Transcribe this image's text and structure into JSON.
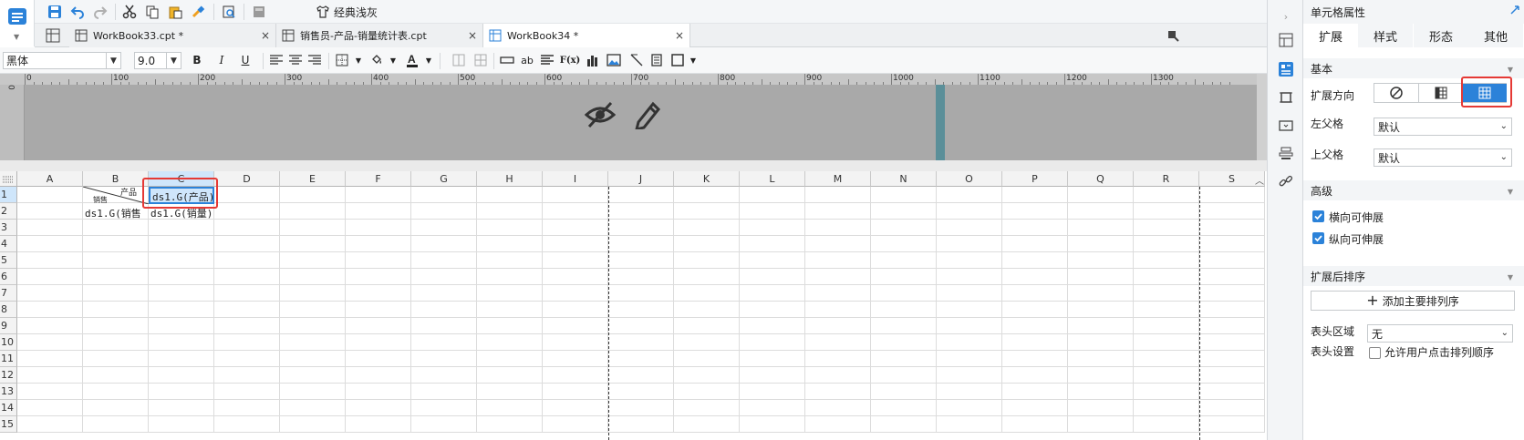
{
  "top_toolbar": {
    "theme_label": "经典浅灰"
  },
  "tabs": [
    {
      "label": "WorkBook33.cpt *",
      "close": "×",
      "active": false
    },
    {
      "label": "销售员-产品-销量统计表.cpt",
      "close": "×",
      "active": false
    },
    {
      "label": "WorkBook34 *",
      "close": "×",
      "active": true
    }
  ],
  "format_toolbar": {
    "font_name": "黑体",
    "font_size": "9.0",
    "bold": "B",
    "italic": "I",
    "underline": "U",
    "wrap_text": "ab",
    "formula": "F(x)"
  },
  "ruler": {
    "labels": [
      "0",
      "100",
      "200",
      "300",
      "400",
      "500",
      "600",
      "700",
      "800",
      "900",
      "1000",
      "1100",
      "1200",
      "1300"
    ],
    "vertical_label": "0"
  },
  "grid": {
    "columns": [
      "A",
      "B",
      "C",
      "D",
      "E",
      "F",
      "G",
      "H",
      "I",
      "J",
      "K",
      "L",
      "M",
      "N",
      "O",
      "P",
      "Q",
      "R",
      "S"
    ],
    "rows": [
      "1",
      "2",
      "3",
      "4",
      "5",
      "6",
      "7",
      "8",
      "9",
      "10",
      "11",
      "12",
      "13",
      "14",
      "15"
    ],
    "cells": {
      "B1_top": "产品",
      "B1_bottom": "销售",
      "C1": "ds1.G(产品)",
      "B2": "ds1.G(销售",
      "C2": "ds1.G(销量)"
    }
  },
  "panel": {
    "title": "单元格属性",
    "tabs": [
      "扩展",
      "样式",
      "形态",
      "其他"
    ],
    "active_tab": "扩展",
    "basic": {
      "header": "基本",
      "direction_label": "扩展方向",
      "left_parent_label": "左父格",
      "left_parent_value": "默认",
      "top_parent_label": "上父格",
      "top_parent_value": "默认"
    },
    "advanced": {
      "header": "高级",
      "horizontal_label": "横向可伸展",
      "horizontal_checked": true,
      "vertical_label": "纵向可伸展",
      "vertical_checked": true
    },
    "sort": {
      "header": "扩展后排序",
      "add_button": "添加主要排列序",
      "header_area_label": "表头区域",
      "header_area_value": "无",
      "header_settings_label": "表头设置",
      "allow_click_sort_label": "允许用户点击排列顺序",
      "allow_click_sort_checked": false
    }
  },
  "colors": {
    "accent": "#2b82d9",
    "highlight_red": "#e53935",
    "selected_cell": "#cfe6fb",
    "header_band": "#a9a9a9"
  }
}
